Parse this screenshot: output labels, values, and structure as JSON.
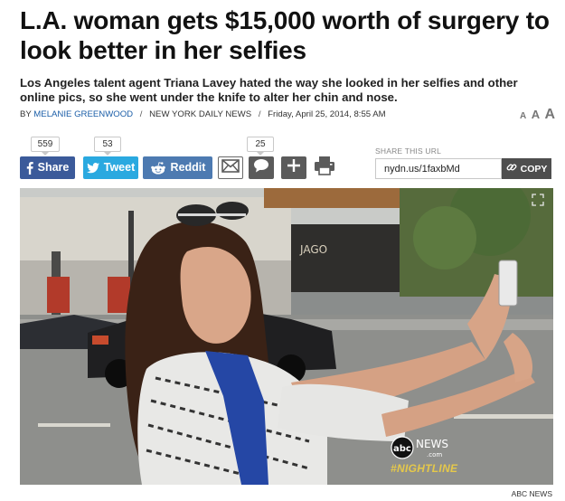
{
  "article": {
    "headline": "L.A. woman gets $15,000 worth of surgery to look better in her selfies",
    "dek": "Los Angeles talent agent Triana Lavey hated the way she looked in her selfies and other online pics, so she went under the knife to alter her chin and nose.",
    "byline_prefix": "BY",
    "author": "MELANIE GREENWOOD",
    "separator": "/",
    "publication": "NEW YORK DAILY NEWS",
    "date": "Friday, April 25, 2014, 8:55 AM"
  },
  "text_size": {
    "small": "A",
    "medium": "A",
    "large": "A"
  },
  "share": {
    "facebook_label": "Share",
    "facebook_count": "559",
    "twitter_label": "Tweet",
    "twitter_count": "53",
    "reddit_label": "Reddit",
    "comment_count": "25",
    "share_url_label": "SHARE THIS URL",
    "share_url_value": "nydn.us/1faxbMd",
    "copy_label": "COPY"
  },
  "video": {
    "storefront_sign": "JAGO",
    "network_logo": "abc",
    "network_word": "NEWS",
    "network_domain": ".com",
    "show_tag": "#NIGHTLINE"
  },
  "photo_credit": "ABC NEWS",
  "colors": {
    "facebook": "#3b5a9a",
    "twitter": "#2aa9e0",
    "reddit": "#4d7ab1",
    "author_link": "#1b5ea8",
    "icon_gray": "#5b5b5b"
  },
  "icons": [
    "facebook-icon",
    "twitter-icon",
    "reddit-icon",
    "email-icon",
    "comment-icon",
    "plus-icon",
    "print-icon",
    "link-icon",
    "expand-icon"
  ]
}
